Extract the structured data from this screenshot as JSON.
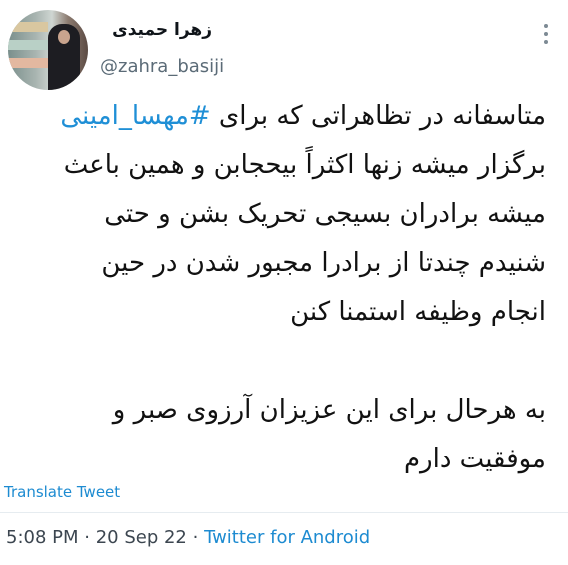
{
  "user": {
    "display_name": "زهرا حمیدی",
    "handle": "@zahra_basiji"
  },
  "tweet": {
    "lines": [
      {
        "before": "متاسفانه در تظاهراتی که برای ",
        "hashtag": "#مهسا_امینی",
        "after": ""
      },
      {
        "text": "برگزار میشه زنها اکثراً بیحجابن و همین باعث"
      },
      {
        "text": "میشه برادران بسیجی تحریک بشن و حتی"
      },
      {
        "text": "شنیدم چندتا از برادرا مجبور شدن در حین"
      },
      {
        "text": "انجام وظیفه استمنا کنن"
      },
      {
        "text": "به هرحال برای این عزیزان آرزوی صبر و"
      },
      {
        "text": "موفقیت دارم"
      }
    ]
  },
  "actions": {
    "translate_label": "Translate Tweet"
  },
  "meta": {
    "time": "5:08 PM",
    "separator1": " · ",
    "date": "20 Sep 22",
    "separator2": " · ",
    "source": "Twitter for Android"
  },
  "icons": {
    "more": "more-options-icon"
  },
  "colors": {
    "link": "#1d8bd1",
    "hashtag": "#1f8fd6",
    "secondary_text": "#5b6b77"
  }
}
